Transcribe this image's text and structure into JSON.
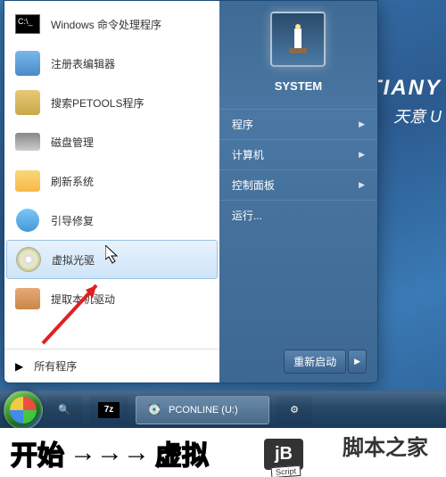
{
  "brand": {
    "en": "TIANY",
    "cn": "天意 U"
  },
  "user": {
    "name": "SYSTEM"
  },
  "apps": [
    {
      "label": "Windows 命令处理程序",
      "icon": "cmd"
    },
    {
      "label": "注册表编辑器",
      "icon": "reg"
    },
    {
      "label": "搜索PETOOLS程序",
      "icon": "search"
    },
    {
      "label": "磁盘管理",
      "icon": "disk"
    },
    {
      "label": "刷新系统",
      "icon": "refresh"
    },
    {
      "label": "引导修复",
      "icon": "boot"
    },
    {
      "label": "虚拟光驱",
      "icon": "cd"
    },
    {
      "label": "提取本机驱动",
      "icon": "driver"
    }
  ],
  "all_programs": "所有程序",
  "sys_links": [
    {
      "label": "程序",
      "expand": true
    },
    {
      "label": "计算机",
      "expand": true
    },
    {
      "label": "控制面板",
      "expand": true
    },
    {
      "label": "运行...",
      "expand": false
    }
  ],
  "shutdown": {
    "label": "重新启动"
  },
  "taskbar": {
    "drive_label": "PCONLINE (U:)",
    "sevenzip": "7z"
  },
  "caption": {
    "text_a": "开始",
    "arrows": "→→→",
    "text_b": "虚拟",
    "logo": "jB",
    "script": "Script",
    "site": "脚本之家"
  }
}
